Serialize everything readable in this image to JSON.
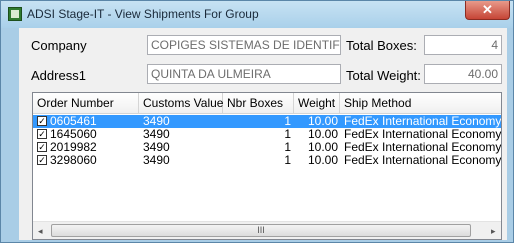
{
  "window": {
    "title": "ADSI Stage-IT - View Shipments For Group",
    "close_glyph": "✕",
    "icon": "app-icon"
  },
  "form": {
    "company_label": "Company",
    "company_value": "COPIGES SISTEMAS DE IDENTIFIC",
    "address1_label": "Address1",
    "address1_value": "QUINTA DA ULMEIRA",
    "total_boxes_label": "Total Boxes:",
    "total_boxes_value": "4",
    "total_weight_label": "Total Weight:",
    "total_weight_value": "40.00"
  },
  "grid": {
    "columns": [
      "Order Number",
      "Customs Value",
      "Nbr Boxes",
      "Weight",
      "Ship Method"
    ],
    "rows": [
      {
        "checked": true,
        "order_number": "0605461",
        "customs_value": "3490",
        "nbr_boxes": "1",
        "weight": "10.00",
        "ship_method": "FedEx International Economy",
        "selected": true
      },
      {
        "checked": true,
        "order_number": "1645060",
        "customs_value": "3490",
        "nbr_boxes": "1",
        "weight": "10.00",
        "ship_method": "FedEx International Economy",
        "selected": false
      },
      {
        "checked": true,
        "order_number": "2019982",
        "customs_value": "3490",
        "nbr_boxes": "1",
        "weight": "10.00",
        "ship_method": "FedEx International Economy",
        "selected": false
      },
      {
        "checked": true,
        "order_number": "3298060",
        "customs_value": "3490",
        "nbr_boxes": "1",
        "weight": "10.00",
        "ship_method": "FedEx International Economy",
        "selected": false
      }
    ],
    "scroll_left_glyph": "◂",
    "scroll_right_glyph": "▸",
    "scroll_thumb_glyph": "III",
    "check_glyph": "✓"
  }
}
